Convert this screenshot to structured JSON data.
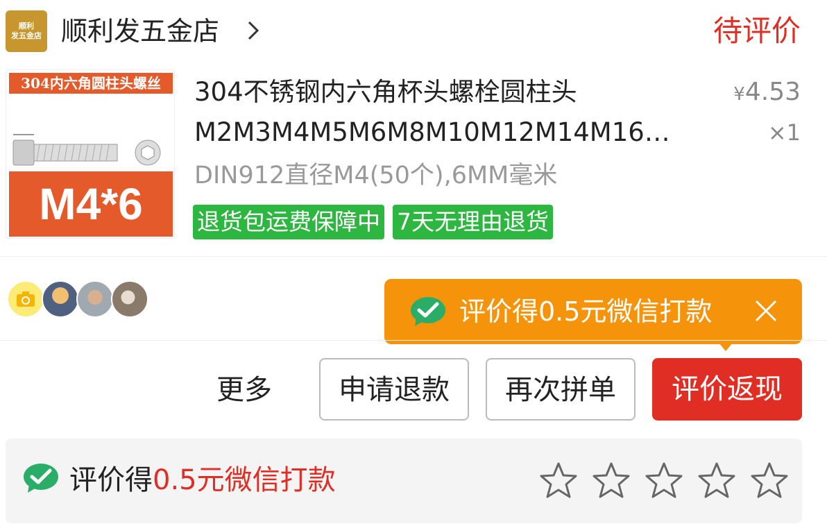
{
  "store": {
    "logo_line1": "顺利",
    "logo_line2": "发五金店",
    "name": "顺利发五金店",
    "status": "待评价"
  },
  "product": {
    "thumb_banner": "304内六角圆柱头螺丝",
    "thumb_size": "M4*6",
    "title_line1": "304不锈钢内六角杯头螺栓圆柱头",
    "title_line2": "M2M3M4M5M6M8M10M12M14M16…",
    "price_symbol": "¥",
    "price": "4.53",
    "quantity": "×1",
    "spec": "DIN912直径M4(50个),6MM毫米",
    "tags": [
      "退货包运费保障中",
      "7天无理由退货"
    ]
  },
  "tooltip": {
    "text": "评价得0.5元微信打款"
  },
  "actions": {
    "more": "更多",
    "refund": "申请退款",
    "rebuy": "再次拼单",
    "review": "评价返现"
  },
  "rating": {
    "prefix": "评价得",
    "highlight": "0.5元微信打款",
    "stars": 5
  },
  "colors": {
    "accent_red": "#e02e24",
    "tag_green": "#2db640",
    "tooltip_orange": "#f5940b",
    "wechat_green": "#2aae67"
  }
}
